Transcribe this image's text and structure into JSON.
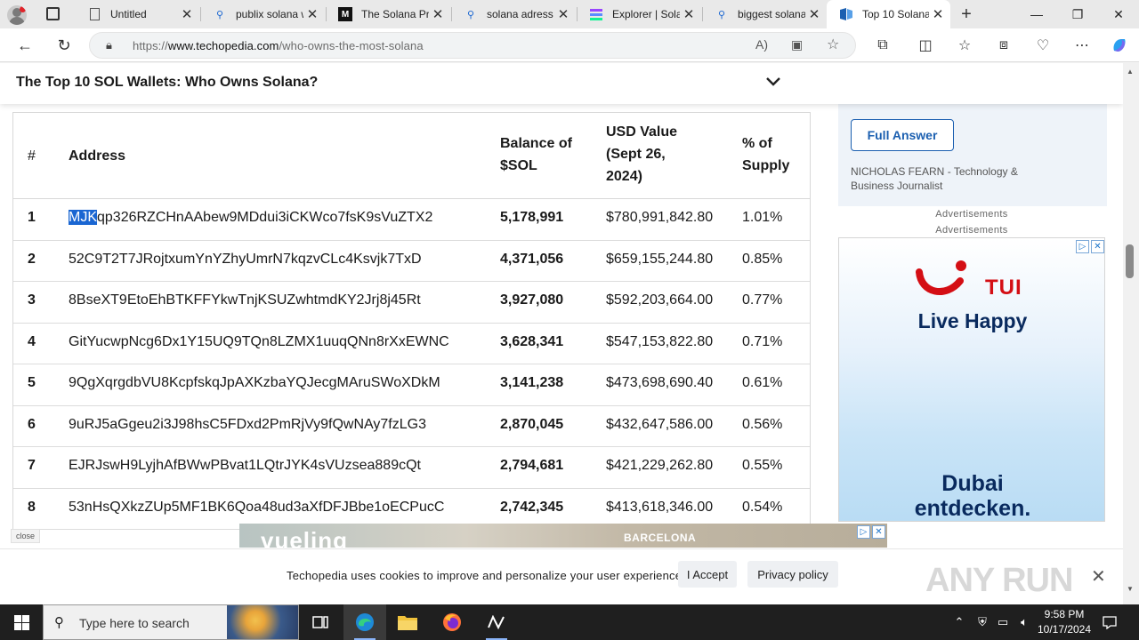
{
  "tabs": [
    {
      "title": "Untitled",
      "icon": "page-icon"
    },
    {
      "title": "publix solana w",
      "icon": "search-icon"
    },
    {
      "title": "The Solana Pro",
      "icon": "medium-icon"
    },
    {
      "title": "solana adress",
      "icon": "search-icon"
    },
    {
      "title": "Explorer | Sola",
      "icon": "solana-explorer-icon"
    },
    {
      "title": "biggest solana",
      "icon": "search-icon"
    },
    {
      "title": "Top 10 Solana",
      "icon": "techopedia-icon"
    }
  ],
  "address_bar": {
    "prefix": "https://",
    "domain": "www.techopedia.com",
    "path": "/who-owns-the-most-solana"
  },
  "page": {
    "sticky_title": "The Top 10 SOL Wallets: Who Owns Solana?",
    "table": {
      "headers": {
        "num": "#",
        "address": "Address",
        "balance_1": "Balance of",
        "balance_2": "$SOL",
        "usd_1": "USD Value",
        "usd_2": "(Sept 26,",
        "usd_3": "2024)",
        "pct_1": "% of",
        "pct_2": "Supply"
      },
      "selected_prefix": "MJK",
      "rows": [
        {
          "num": "1",
          "address": "qp326RZCHnAAbew9MDdui3iCKWco7fsK9sVuZTX2",
          "balance": "5,178,991",
          "usd": "$780,991,842.80",
          "pct": "1.01%"
        },
        {
          "num": "2",
          "address": "52C9T2T7JRojtxumYnYZhyUmrN7kqzvCLc4Ksvjk7TxD",
          "balance": "4,371,056",
          "usd": "$659,155,244.80",
          "pct": "0.85%"
        },
        {
          "num": "3",
          "address": "8BseXT9EtoEhBTKFFYkwTnjKSUZwhtmdKY2Jrj8j45Rt",
          "balance": "3,927,080",
          "usd": "$592,203,664.00",
          "pct": "0.77%"
        },
        {
          "num": "4",
          "address": "GitYucwpNcg6Dx1Y15UQ9TQn8LZMX1uuqQNn8rXxEWNC",
          "balance": "3,628,341",
          "usd": "$547,153,822.80",
          "pct": "0.71%"
        },
        {
          "num": "5",
          "address": "9QgXqrgdbVU8KcpfskqJpAXKzbaYQJecgMAruSWoXDkM",
          "balance": "3,141,238",
          "usd": "$473,698,690.40",
          "pct": "0.61%"
        },
        {
          "num": "6",
          "address": "9uRJ5aGgeu2i3J98hsC5FDxd2PmRjVy9fQwNAy7fzLG3",
          "balance": "2,870,045",
          "usd": "$432,647,586.00",
          "pct": "0.56%"
        },
        {
          "num": "7",
          "address": "EJRJswH9LyjhAfBWwPBvat1LQtrJYK4sVUzsea889cQt",
          "balance": "2,794,681",
          "usd": "$421,229,262.80",
          "pct": "0.55%"
        },
        {
          "num": "8",
          "address": "53nHsQXkzZUp5MF1BK6Qoa48ud3aXfDFJBbe1oECPucC",
          "balance": "2,742,345",
          "usd": "$413,618,346.00",
          "pct": "0.54%"
        }
      ]
    },
    "sidebar": {
      "full_answer": "Full Answer",
      "author_name": "NICHOLAS FEARN",
      "author_role": "- Technology & Business Journalist",
      "ad_label": "Advertisements",
      "ad": {
        "brand": "TUI",
        "tagline": "Live Happy",
        "headline_1": "Dubai",
        "headline_2": "entdecken."
      }
    },
    "close_label": "close",
    "banner_ad": {
      "brand": "vueling",
      "city": "BARCELONA"
    },
    "cookie": {
      "message": "Techopedia uses cookies to improve and personalize your user experience",
      "accept": "I Accept",
      "privacy": "Privacy policy"
    },
    "watermark": "ANY RUN"
  },
  "taskbar": {
    "search_placeholder": "Type here to search",
    "time": "9:58 PM",
    "date": "10/17/2024"
  },
  "colors": {
    "accent": "#1b5fb0",
    "selection": "#1a66d2",
    "tui_red": "#d40e14",
    "tui_navy": "#092a5e"
  }
}
